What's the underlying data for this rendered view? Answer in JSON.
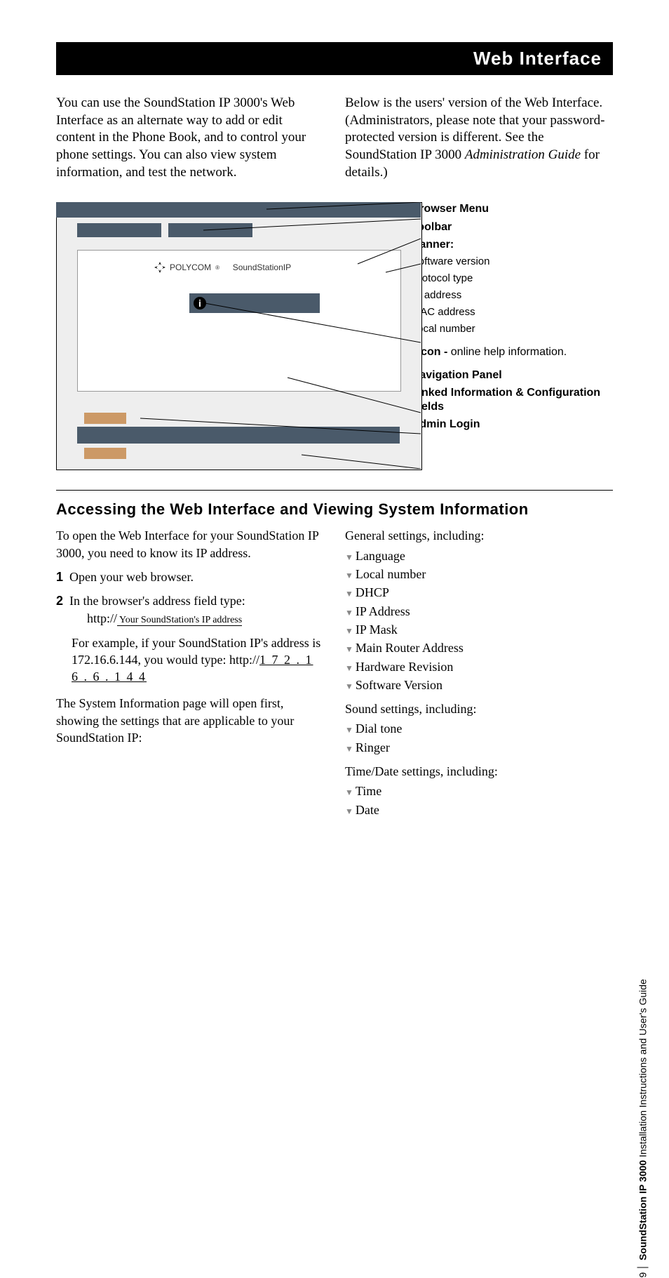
{
  "banner": {
    "title": "Web Interface"
  },
  "intro": {
    "left": "You can use the SoundStation IP 3000's Web Interface as an alternate way to add or edit content in the Phone Book, and to control your phone settings. You can also view system information, and test the network.",
    "right_a": "Below is the users' version of the Web Interface. (Administrators, please note that your password-protected version is different. See the SoundStation IP 3000 ",
    "right_em": "Administration Guide",
    "right_b": " for details.)"
  },
  "diagram": {
    "brand_a": "POLYCOM",
    "brand_reg": "®",
    "brand_b": "SoundStationIP",
    "labels": {
      "browser_menu": "Browser Menu",
      "toolbar": "Toolbar",
      "banner_head": "Banner:",
      "banner_items": [
        "Software version",
        "Protocol type",
        "IP address",
        "MAC address",
        "Local number"
      ],
      "iicon_a": "i Icon - ",
      "iicon_b": "online help information.",
      "nav": "Navigation Panel",
      "linked": "Linked Information & Configuration Fields",
      "admin": "Admin Login"
    }
  },
  "section": {
    "heading": "Accessing the Web Interface and Viewing System Information",
    "left": {
      "p1": "To open the Web Interface for your SoundStation IP 3000, you need to know its IP address.",
      "step1": "Open your web browser.",
      "step2a": "In the browser's address field type:",
      "step2b_prefix": "http://",
      "step2b_field": " Your SoundStation's IP address ",
      "example_a": "For example, if your SoundStation IP's address is 172.16.6.144, you would type: http://",
      "example_ip": "1 7 2 . 1 6 . 6 . 1 4 4",
      "p2": "The System Information page will open first, showing the settings that are applicable to your SoundStation IP:"
    },
    "right": {
      "gen_head": "General settings, including:",
      "gen": [
        "Language",
        "Local number",
        "DHCP",
        "IP Address",
        "IP Mask",
        "Main Router Address",
        "Hardware Revision",
        "Software Version"
      ],
      "sound_head": "Sound settings, including:",
      "sound": [
        "Dial tone",
        "Ringer"
      ],
      "time_head": "Time/Date settings, including:",
      "time": [
        "Time",
        "Date"
      ]
    }
  },
  "side": {
    "page": "9",
    "bold": "SoundStation IP 3000",
    "rest": " Installation Instructions and User's Guide"
  }
}
